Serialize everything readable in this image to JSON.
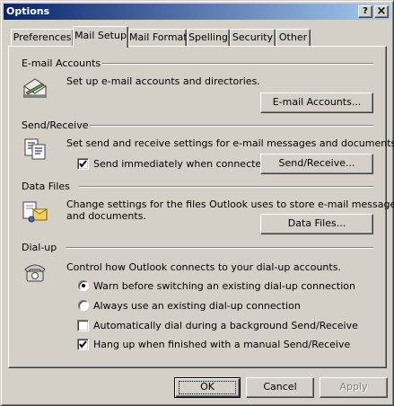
{
  "window": {
    "title": "Options"
  },
  "title_buttons": {
    "help": "?",
    "close": "×"
  },
  "tabs": [
    {
      "label": "Preferences"
    },
    {
      "label": "Mail Setup"
    },
    {
      "label": "Mail Format"
    },
    {
      "label": "Spelling"
    },
    {
      "label": "Security"
    },
    {
      "label": "Other"
    }
  ],
  "email_accounts": {
    "heading": "E-mail Accounts",
    "icon": "mail-accounts-icon",
    "description": "Set up e-mail accounts and directories.",
    "button": "E-mail Accounts..."
  },
  "send_receive": {
    "heading": "Send/Receive",
    "icon": "send-receive-icon",
    "description": "Set send and receive settings for e-mail messages and documents.",
    "checkbox_label": "Send immediately when connected",
    "checkbox_checked": true,
    "button": "Send/Receive..."
  },
  "data_files": {
    "heading": "Data Files",
    "icon": "data-files-icon",
    "description_line1": "Change settings for the files Outlook uses to store e-mail messages",
    "description_line2": "and documents.",
    "button": "Data Files..."
  },
  "dialup": {
    "heading": "Dial-up",
    "icon": "telephone-icon",
    "description": "Control how Outlook connects to your dial-up accounts.",
    "radio_warn": "Warn before switching an existing dial-up connection",
    "radio_always": "Always use an existing dial-up connection",
    "selected_radio": "warn",
    "check_auto_dial": "Automatically dial during a background Send/Receive",
    "check_auto_dial_checked": false,
    "check_hangup": "Hang up when finished with a manual Send/Receive",
    "check_hangup_checked": true
  },
  "footer": {
    "ok": "OK",
    "cancel": "Cancel",
    "apply": "Apply"
  },
  "colors": {
    "face": "#d4d0c8",
    "titlebar_start": "#0a246a",
    "titlebar_end": "#a6caf0"
  }
}
